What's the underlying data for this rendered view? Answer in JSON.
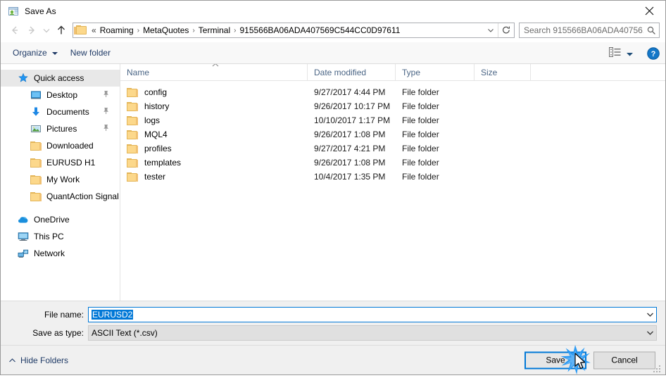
{
  "window": {
    "title": "Save As",
    "title_icon": "save-as-window-icon",
    "close_icon": "close-icon"
  },
  "nav": {
    "back_icon": "arrow-left-icon",
    "forward_icon": "arrow-right-icon",
    "recent_icon": "chevron-down-icon",
    "up_icon": "arrow-up-icon",
    "folder_icon": "folder-icon",
    "overflow": "«",
    "crumbs": [
      "Roaming",
      "MetaQuotes",
      "Terminal",
      "915566BA06ADA407569C544CC0D97611"
    ],
    "separator": "›",
    "dropdown_icon": "chevron-down-icon",
    "refresh_icon": "refresh-icon"
  },
  "search": {
    "placeholder": "Search 915566BA06ADA40756...",
    "icon": "search-icon"
  },
  "commandbar": {
    "organize_label": "Organize",
    "organize_caret_icon": "caret-down-icon",
    "new_folder_label": "New folder",
    "view_icon": "view-layout-icon",
    "view_caret_icon": "caret-down-icon",
    "help_icon": "help-icon",
    "help_label": "?"
  },
  "sidebar": {
    "items": [
      {
        "label": "Quick access",
        "icon": "star-icon",
        "level": 0,
        "selected": true,
        "pinned": false
      },
      {
        "label": "Desktop",
        "icon": "desktop-icon",
        "level": 1,
        "selected": false,
        "pinned": true
      },
      {
        "label": "Documents",
        "icon": "documents-icon",
        "level": 1,
        "selected": false,
        "pinned": true
      },
      {
        "label": "Pictures",
        "icon": "pictures-icon",
        "level": 1,
        "selected": false,
        "pinned": true
      },
      {
        "label": "Downloaded",
        "icon": "folder-icon",
        "level": 1,
        "selected": false,
        "pinned": false
      },
      {
        "label": "EURUSD H1",
        "icon": "folder-icon",
        "level": 1,
        "selected": false,
        "pinned": false
      },
      {
        "label": "My Work",
        "icon": "folder-icon",
        "level": 1,
        "selected": false,
        "pinned": false
      },
      {
        "label": "QuantAction Signal",
        "icon": "folder-icon",
        "level": 1,
        "selected": false,
        "pinned": false
      },
      {
        "label": "OneDrive",
        "icon": "onedrive-icon",
        "level": 0,
        "selected": false,
        "pinned": false
      },
      {
        "label": "This PC",
        "icon": "thispc-icon",
        "level": 0,
        "selected": false,
        "pinned": false
      },
      {
        "label": "Network",
        "icon": "network-icon",
        "level": 0,
        "selected": false,
        "pinned": false
      }
    ]
  },
  "filelist": {
    "sort_indicator_icon": "sort-ascending-icon",
    "columns": [
      "Name",
      "Date modified",
      "Type",
      "Size"
    ],
    "rows": [
      {
        "name": "config",
        "date": "9/27/2017 4:44 PM",
        "type": "File folder",
        "size": ""
      },
      {
        "name": "history",
        "date": "9/26/2017 10:17 PM",
        "type": "File folder",
        "size": ""
      },
      {
        "name": "logs",
        "date": "10/10/2017 1:17 PM",
        "type": "File folder",
        "size": ""
      },
      {
        "name": "MQL4",
        "date": "9/26/2017 1:08 PM",
        "type": "File folder",
        "size": ""
      },
      {
        "name": "profiles",
        "date": "9/27/2017 4:21 PM",
        "type": "File folder",
        "size": ""
      },
      {
        "name": "templates",
        "date": "9/26/2017 1:08 PM",
        "type": "File folder",
        "size": ""
      },
      {
        "name": "tester",
        "date": "10/4/2017 1:35 PM",
        "type": "File folder",
        "size": ""
      }
    ]
  },
  "form": {
    "filename_label": "File name:",
    "filename_value": "EURUSD2",
    "filetype_label": "Save as type:",
    "filetype_value": "ASCII Text (*.csv)",
    "dropdown_icon": "chevron-down-icon"
  },
  "footer": {
    "hide_folders_label": "Hide Folders",
    "hide_folders_icon": "caret-up-icon",
    "save_label": "Save",
    "cancel_label": "Cancel",
    "resize_grip_icon": "resize-grip-icon"
  },
  "pointer": {
    "cursor_icon": "mouse-pointer-icon",
    "click_effect_icon": "click-burst-icon"
  },
  "colors": {
    "accent": "#0078d7",
    "selection_text": "#0078d7",
    "chrome": "#f0f0f0",
    "folder": "#fcd88b"
  }
}
